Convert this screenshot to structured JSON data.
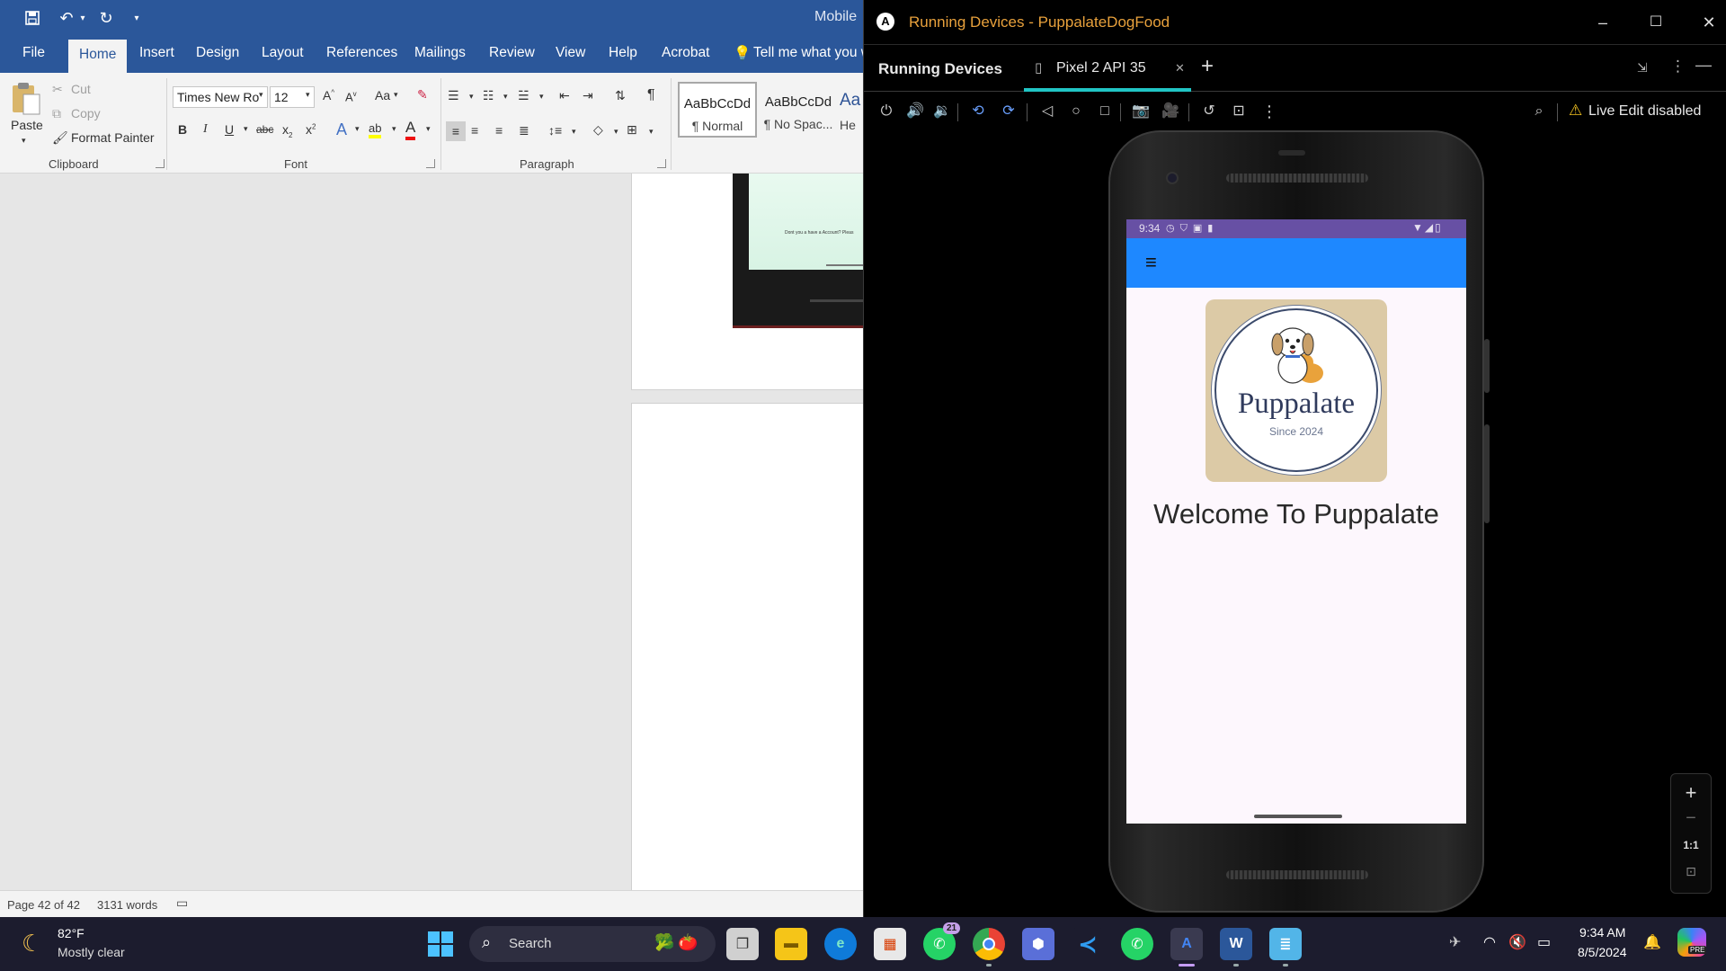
{
  "word": {
    "doc_title": "Mobile",
    "tabs": [
      "File",
      "Home",
      "Insert",
      "Design",
      "Layout",
      "References",
      "Mailings",
      "Review",
      "View",
      "Help",
      "Acrobat"
    ],
    "active_tab": "Home",
    "tell_me": "Tell me what you w",
    "clipboard": {
      "paste": "Paste",
      "cut": "Cut",
      "copy": "Copy",
      "format_painter": "Format Painter",
      "label": "Clipboard"
    },
    "font": {
      "family": "Times New Ro",
      "size": "12",
      "label": "Font",
      "bold": "B",
      "italic": "I",
      "underline": "U",
      "strike": "abc",
      "change_case": "Aa"
    },
    "paragraph": {
      "label": "Paragraph",
      "pilcrow": "¶"
    },
    "styles": [
      {
        "sample": "AaBbCcDd",
        "name": "¶ Normal"
      },
      {
        "sample": "AaBbCcDd",
        "name": "¶ No Spac..."
      },
      {
        "sample": "Aa",
        "name": "He"
      }
    ],
    "status": {
      "page": "Page 42 of 42",
      "words": "3131 words"
    },
    "embedded_page_text": "Dont you a have a Account? Pleas"
  },
  "android_studio": {
    "window_title": "Running Devices - PuppalateDogFood",
    "panel_title": "Running Devices",
    "device_tab": "Pixel 2 API 35",
    "live_edit": "Live Edit disabled",
    "zoom": {
      "plus": "+",
      "minus": "−",
      "one_to_one": "1:1"
    },
    "emulator": {
      "status_time": "9:34",
      "logo_brand": "Puppalate",
      "logo_since": "Since 2024",
      "welcome": "Welcome To Puppalate"
    },
    "colors": {
      "title_text": "#e8a13c",
      "tab_underline": "#21c5c5",
      "status_bar": "#6750a4",
      "app_bar": "#1e88ff"
    }
  },
  "taskbar": {
    "weather_temp": "82°F",
    "weather_desc": "Mostly clear",
    "search": "Search",
    "whatsapp_badge": "21",
    "time": "9:34 AM",
    "date": "8/5/2024",
    "copilot_tag": "PRE"
  }
}
